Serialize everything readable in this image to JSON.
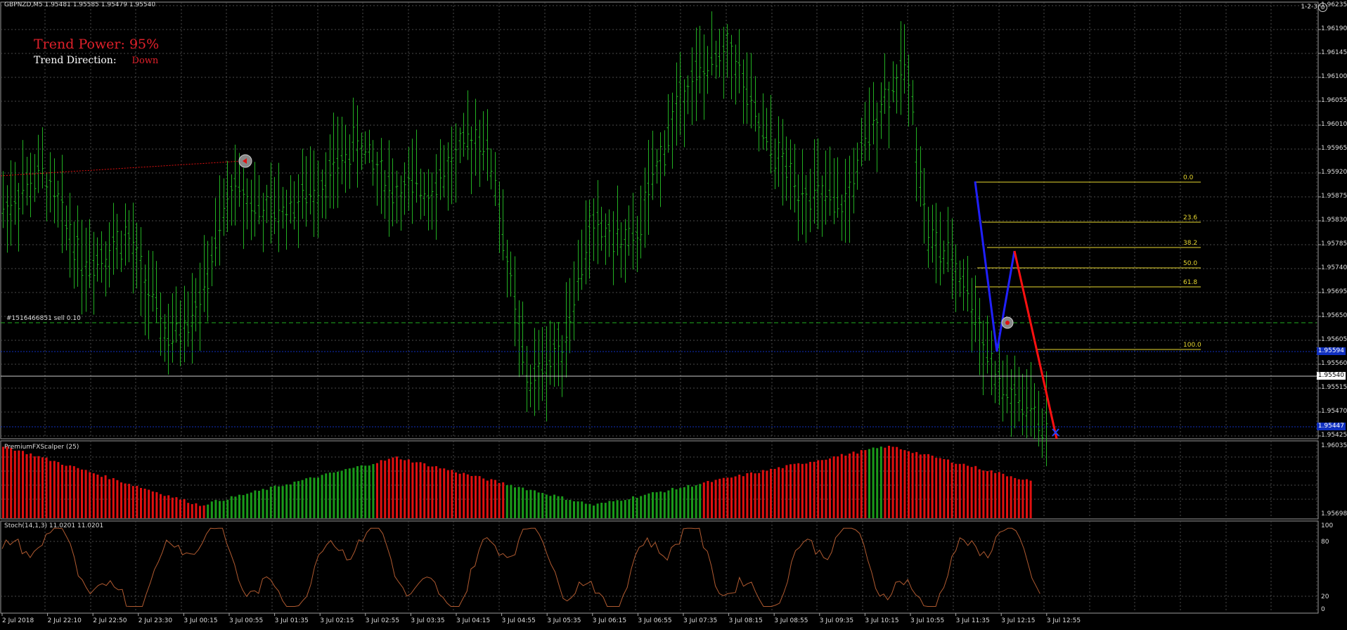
{
  "header": {
    "symbol_line": "GBPNZD,M5  1.95481 1.95585 1.95479 1.95540",
    "zoom_label": "1-2-3",
    "settings_icon": "gear-icon"
  },
  "trend": {
    "power_label": "Trend Power:",
    "power_value": "95%",
    "direction_label": "Trend Direction:",
    "direction_value": "Down"
  },
  "order": {
    "label": "#1516466851 sell 0.10"
  },
  "price_axis": {
    "labels": [
      "1.96235",
      "1.96190",
      "1.96145",
      "1.96100",
      "1.96055",
      "1.96010",
      "1.95965",
      "1.95920",
      "1.95875",
      "1.95830",
      "1.95785",
      "1.95740",
      "1.95695",
      "1.95650",
      "1.95605",
      "1.95560",
      "1.95515",
      "1.95470",
      "1.95425"
    ],
    "current_price": "1.95540",
    "level_tags": [
      "1.95594",
      "1.95447"
    ]
  },
  "fibonacci": {
    "levels": [
      "0.0",
      "23.6",
      "38.2",
      "50.0",
      "61.8",
      "100.0"
    ]
  },
  "time_axis": {
    "labels": [
      "2 Jul 2018",
      "2 Jul 22:10",
      "2 Jul 22:50",
      "2 Jul 23:30",
      "3 Jul 00:15",
      "3 Jul 00:55",
      "3 Jul 01:35",
      "3 Jul 02:15",
      "3 Jul 02:55",
      "3 Jul 03:35",
      "3 Jul 04:15",
      "3 Jul 04:55",
      "3 Jul 05:35",
      "3 Jul 06:15",
      "3 Jul 06:55",
      "3 Jul 07:35",
      "3 Jul 08:15",
      "3 Jul 08:55",
      "3 Jul 09:35",
      "3 Jul 10:15",
      "3 Jul 10:55",
      "3 Jul 11:35",
      "3 Jul 12:15",
      "3 Jul 12:55"
    ]
  },
  "scalper_pane": {
    "title": "PremiumFXScalper (25)",
    "axis_labels": [
      "1.96035",
      "1.95698"
    ]
  },
  "stoch_pane": {
    "title": "Stoch(14,1,3) 11.0201 11.0201",
    "axis_labels": [
      "100",
      "80",
      "20",
      "0"
    ]
  },
  "colors": {
    "background": "#000000",
    "grid": "#4a4a4a",
    "bars": "#22b022",
    "fib": "#e8d830",
    "zigzag_up": "#2020ff",
    "zigzag_down": "#ff1010",
    "hist_red": "#e01010",
    "hist_green": "#1a9a1a",
    "stoch_line": "#b05a30"
  }
}
